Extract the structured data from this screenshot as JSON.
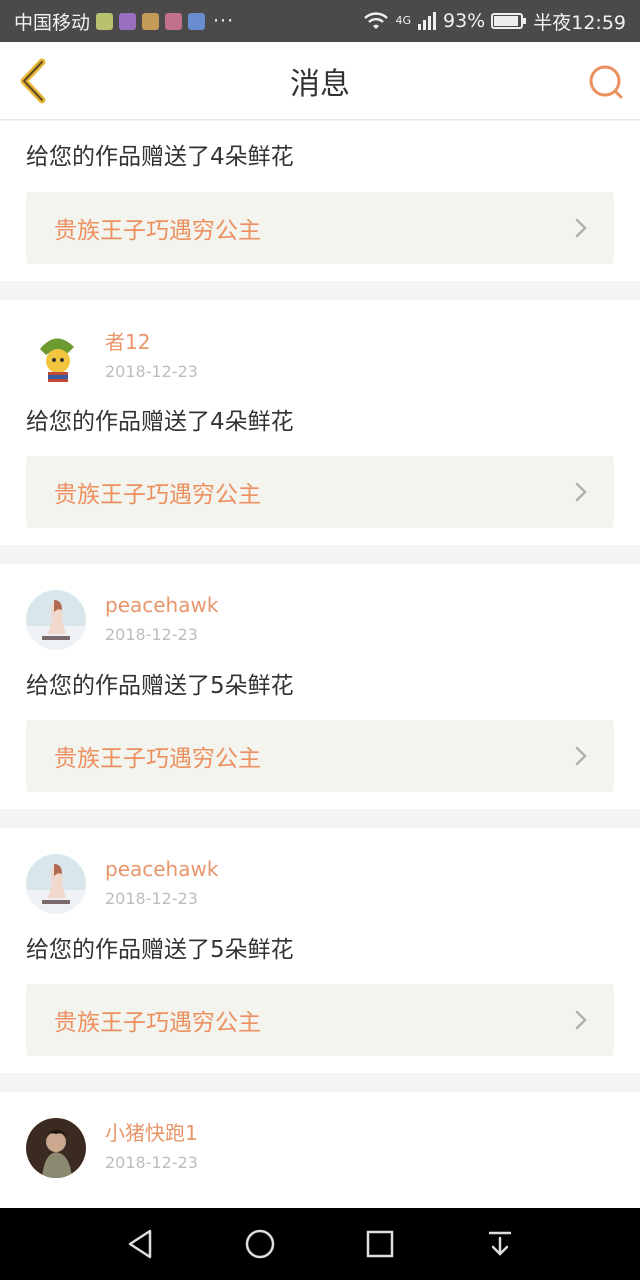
{
  "status_bar": {
    "carrier": "中国移动",
    "overflow": "···",
    "network": "4G",
    "battery_percent": "93%",
    "battery_level": 0.93,
    "time": "半夜12:59"
  },
  "header": {
    "title": "消息",
    "back_icon": "chevron-left-icon",
    "search_icon": "search-icon"
  },
  "colors": {
    "accent": "#e9956a",
    "link_bg": "#f4f4ee"
  },
  "messages": [
    {
      "username": "",
      "date": "",
      "text": "给您的作品赠送了4朵鲜花",
      "work_title": "贵族王子巧遇穷公主"
    },
    {
      "username": "者12",
      "date": "2018-12-23",
      "text": "给您的作品赠送了4朵鲜花",
      "work_title": "贵族王子巧遇穷公主"
    },
    {
      "username": "peacehawk",
      "date": "2018-12-23",
      "text": "给您的作品赠送了5朵鲜花",
      "work_title": "贵族王子巧遇穷公主"
    },
    {
      "username": "peacehawk",
      "date": "2018-12-23",
      "text": "给您的作品赠送了5朵鲜花",
      "work_title": "贵族王子巧遇穷公主"
    },
    {
      "username": "小猪快跑1",
      "date": "2018-12-23",
      "text": "",
      "work_title": ""
    }
  ],
  "nav_bar": {
    "back": "back-triangle-icon",
    "home": "home-circle-icon",
    "recents": "recents-square-icon",
    "notifications": "pull-down-icon"
  }
}
